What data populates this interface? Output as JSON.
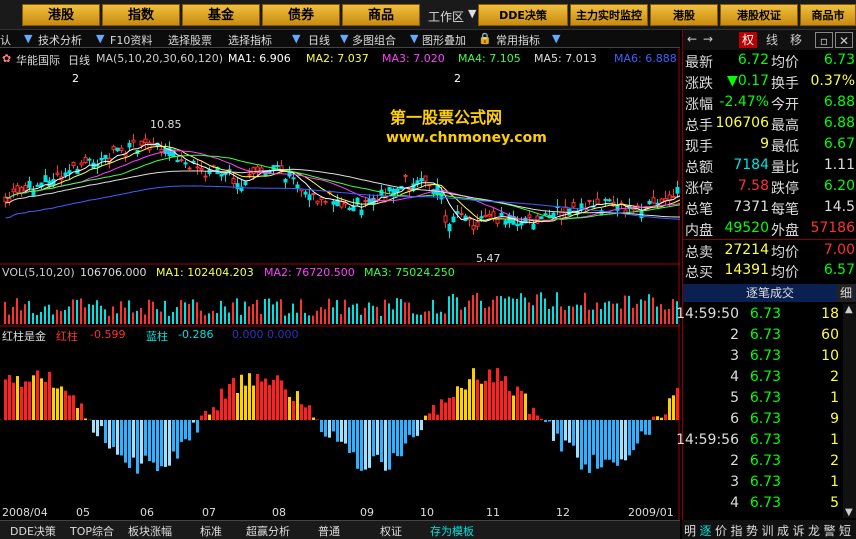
{
  "topbar": {
    "buttons": [
      "港股",
      "指数",
      "基金",
      "债券",
      "商品"
    ],
    "workarea": "工作区",
    "right_buttons": [
      "DDE决策",
      "主力实时监控",
      "港股",
      "港股权证",
      "商品市"
    ]
  },
  "toolbar": {
    "items": [
      "认",
      "技术分析",
      "F10资料",
      "选择股票",
      "选择指标",
      "日线",
      "多图组合",
      "图形叠加",
      "常用指标"
    ]
  },
  "main_chart": {
    "stock_name": "华能国际",
    "period": "日线",
    "ma_label": "MA(5,10,20,30,60,120)",
    "ma1": "MA1: 6.906",
    "ma2": "MA2: 7.037",
    "ma3": "MA3: 7.020",
    "ma4": "MA4: 7.105",
    "ma5": "MA5: 7.013",
    "ma6": "MA6: 6.888",
    "high_label": "10.85",
    "low_label": "5.47",
    "watermark_title": "第一股票公式网",
    "watermark_url": "www.chnmoney.com",
    "markers": [
      "2",
      "2"
    ]
  },
  "vol_chart": {
    "label": "VOL(5,10,20)",
    "value": "106706.000",
    "ma1": "MA1: 102404.203",
    "ma2": "MA2: 76720.500",
    "ma3": "MA3: 75024.250"
  },
  "indicator": {
    "name": "红柱是金",
    "red_label": "红柱",
    "red_value": "-0.599",
    "blue_label": "蓝柱",
    "blue_value": "-0.286",
    "extra": "0.000 0.000"
  },
  "date_axis": [
    "2008/04",
    "05",
    "06",
    "07",
    "08",
    "09",
    "10",
    "11",
    "12",
    "2009/01"
  ],
  "bottom_tabs": [
    "DDE决策",
    "TOP综合",
    "板块涨幅",
    "标准",
    "超赢分析",
    "普通",
    "权证",
    "存为模板"
  ],
  "right_tabs": [
    "权",
    "线",
    "移"
  ],
  "quote": [
    {
      "l1": "最新",
      "v1": "6.72",
      "l2": "均价",
      "v2": "6.73"
    },
    {
      "l1": "涨跌",
      "v1": "▼0.17",
      "l2": "换手",
      "v2": "0.37%"
    },
    {
      "l1": "涨幅",
      "v1": "-2.47%",
      "l2": "今开",
      "v2": "6.88"
    },
    {
      "l1": "总手",
      "v1": "106706",
      "l2": "最高",
      "v2": "6.88"
    },
    {
      "l1": "现手",
      "v1": "9",
      "l2": "最低",
      "v2": "6.67"
    },
    {
      "l1": "总额",
      "v1": "7184",
      "l2": "量比",
      "v2": "1.11"
    },
    {
      "l1": "涨停",
      "v1": "7.58",
      "l2": "跌停",
      "v2": "6.20"
    },
    {
      "l1": "总笔",
      "v1": "7371",
      "l2": "每笔",
      "v2": "14.5"
    },
    {
      "l1": "内盘",
      "v1": "49520",
      "l2": "外盘",
      "v2": "57186"
    },
    {
      "l1": "总卖",
      "v1": "27214",
      "l2": "均价",
      "v2": "7.00"
    },
    {
      "l1": "总买",
      "v1": "14391",
      "l2": "均价",
      "v2": "6.57"
    }
  ],
  "trade_head": "逐笔成交",
  "trade_head_right": "细",
  "trades": [
    {
      "t": "14:59:50",
      "p": "6.73",
      "v": "18"
    },
    {
      "t": "2",
      "p": "6.73",
      "v": "60"
    },
    {
      "t": "3",
      "p": "6.73",
      "v": "10"
    },
    {
      "t": "4",
      "p": "6.73",
      "v": "2"
    },
    {
      "t": "5",
      "p": "6.73",
      "v": "1"
    },
    {
      "t": "6",
      "p": "6.73",
      "v": "9"
    },
    {
      "t": "14:59:56",
      "p": "6.73",
      "v": "1"
    },
    {
      "t": "2",
      "p": "6.73",
      "v": "2"
    },
    {
      "t": "3",
      "p": "6.73",
      "v": "1"
    },
    {
      "t": "4",
      "p": "6.73",
      "v": "5"
    }
  ],
  "bottom_right_tabs": [
    "明",
    "逐",
    "价",
    "指",
    "势",
    "训",
    "成",
    "诉",
    "龙",
    "警",
    "短"
  ],
  "colors": {
    "up": "#ff3030",
    "down": "#00e0e0",
    "price_up": "#00ff00",
    "yellow": "#ffff40",
    "gold": "#ffd000"
  }
}
